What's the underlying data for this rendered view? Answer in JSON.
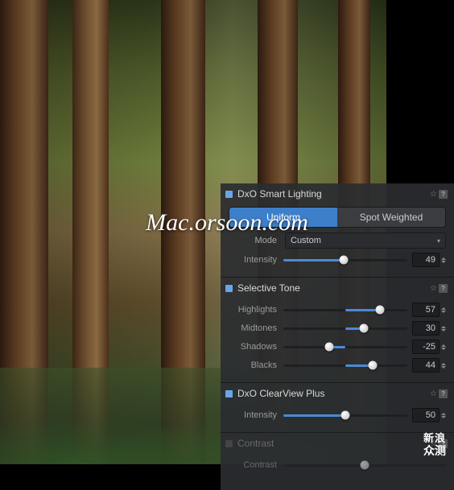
{
  "watermark": "Mac.orsoon.com",
  "corner_logo": {
    "line1": "新浪",
    "line2": "众测"
  },
  "panel": {
    "smart_lighting": {
      "title": "DxO Smart Lighting",
      "tabs": {
        "uniform": "Uniform",
        "spot_weighted": "Spot Weighted"
      },
      "mode_label": "Mode",
      "mode_value": "Custom",
      "intensity_label": "Intensity",
      "intensity_value": "49"
    },
    "selective_tone": {
      "title": "Selective Tone",
      "highlights_label": "Highlights",
      "highlights_value": "57",
      "midtones_label": "Midtones",
      "midtones_value": "30",
      "shadows_label": "Shadows",
      "shadows_value": "-25",
      "blacks_label": "Blacks",
      "blacks_value": "44"
    },
    "clearview": {
      "title": "DxO ClearView Plus",
      "intensity_label": "Intensity",
      "intensity_value": "50"
    },
    "contrast": {
      "title": "Contrast",
      "contrast_label": "Contrast"
    }
  }
}
